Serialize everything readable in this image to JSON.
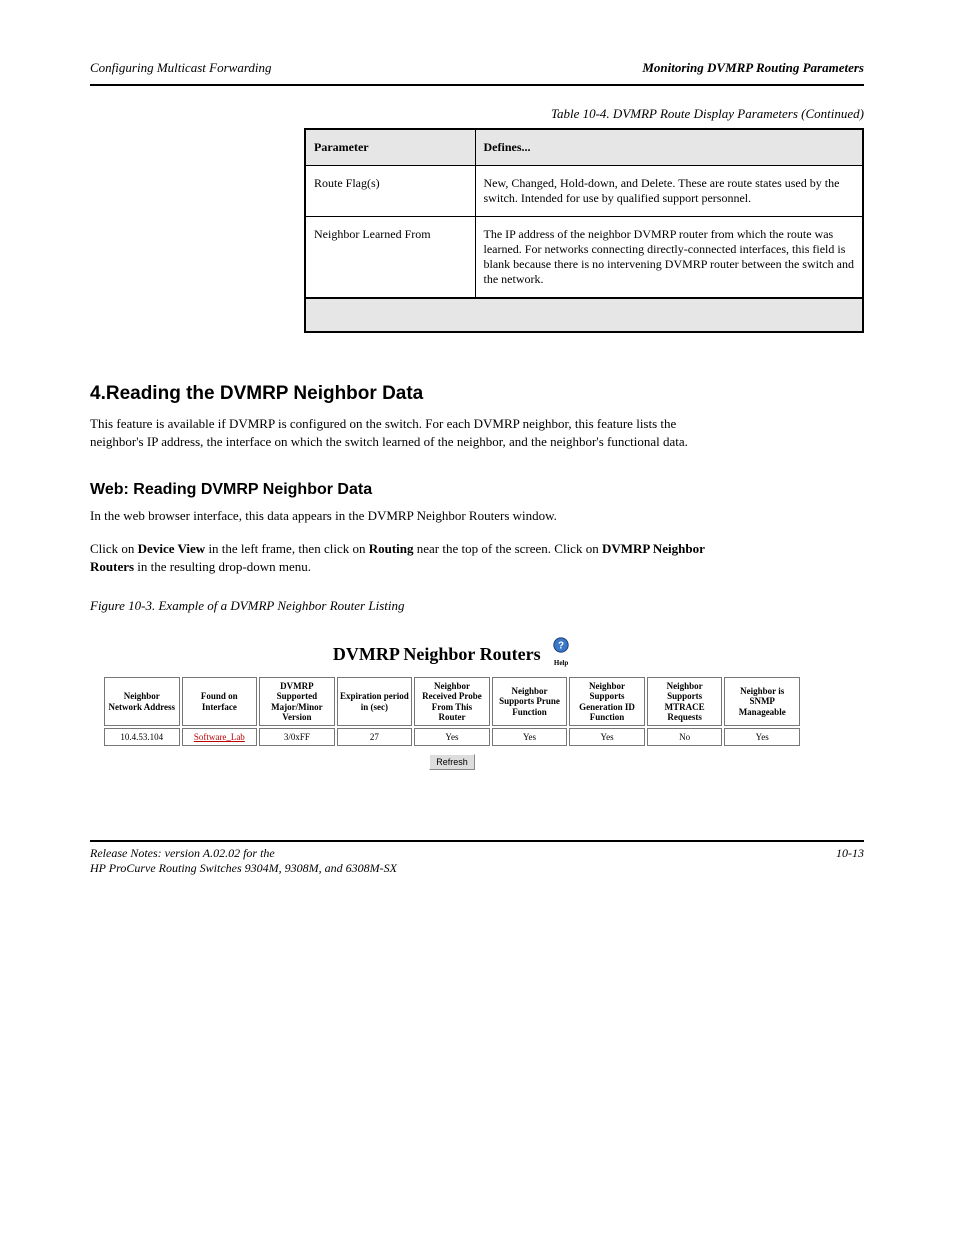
{
  "header": {
    "left": "Configuring Multicast Forwarding",
    "right": "Monitoring DVMRP Routing Parameters"
  },
  "table_caption": "Table 10-4. DVMRP Route Display Parameters (Continued)",
  "param_table": {
    "headers": {
      "param": "Parameter",
      "defines": "Defines..."
    },
    "rows": [
      {
        "param": "Route Flag(s)",
        "defines": "New, Changed, Hold-down, and Delete. These are route states used by the switch. Intended for use by qualified support personnel."
      },
      {
        "param": "Neighbor Learned From",
        "defines": "The IP address of the neighbor DVMRP router from which the route was learned. For networks connecting directly-connected interfaces, this field is blank because there is no intervening DVMRP router between the switch and the network."
      }
    ]
  },
  "section_heading": "4.Reading the DVMRP Neighbor Data",
  "section_para": "This feature is available if DVMRP is configured on the switch. For each DVMRP neighbor, this feature lists the neighbor's IP address, the interface on which the switch learned of the neighbor, and the neighbor's functional data.",
  "web_heading": "Web: Reading DVMRP Neighbor Data",
  "web_para1": "In the web browser interface, this data appears in the DVMRP Neighbor Routers window.",
  "nav": {
    "prefix": "Click on ",
    "step1": "Device View",
    "sep1": " in the left frame, then click on ",
    "step2": "Routing",
    "sep2": " near the top of the screen. Click on ",
    "step3": "DVMRP Neighbor Routers",
    "suffix": " in the resulting drop-down menu."
  },
  "figure_caption": "Figure 10-3. Example of a DVMRP Neighbor Router Listing",
  "shot": {
    "title": "DVMRP Neighbor Routers",
    "help_label": "Help",
    "headers": [
      "Neighbor Network Address",
      "Found on Interface",
      "DVMRP Supported Major/Minor Version",
      "Expiration period in (sec)",
      "Neighbor Received Probe From This Router",
      "Neighbor Supports Prune Function",
      "Neighbor Supports Generation ID Function",
      "Neighbor Supports MTRACE Requests",
      "Neighbor is SNMP Manageable"
    ],
    "row": {
      "addr": "10.4.53.104",
      "intf": "Software_Lab",
      "ver": "3/0xFF",
      "exp": "27",
      "probe": "Yes",
      "prune": "Yes",
      "genid": "Yes",
      "mtrace": "No",
      "snmp": "Yes"
    },
    "refresh": "Refresh"
  },
  "footer": {
    "left": "Release Notes: version A.02.02 for the",
    "mid": "HP ProCurve Routing Switches 9304M, 9308M, and 6308M-SX",
    "right": "10-13"
  }
}
